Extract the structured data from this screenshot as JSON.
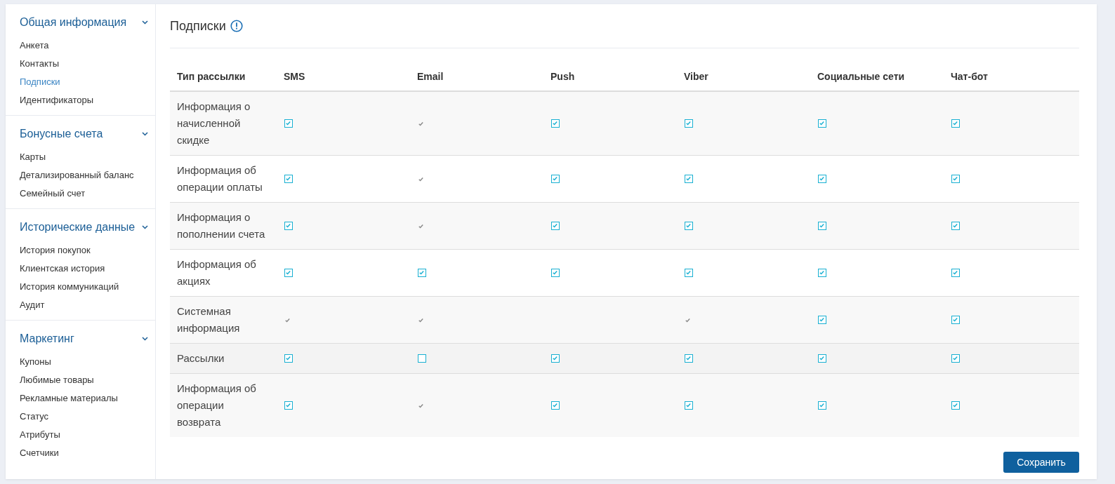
{
  "sidebar": {
    "groups": [
      {
        "title": "Общая информация",
        "expanded": true,
        "items": [
          {
            "label": "Анкета",
            "selected": false
          },
          {
            "label": "Контакты",
            "selected": false
          },
          {
            "label": "Подписки",
            "selected": true
          },
          {
            "label": "Идентификаторы",
            "selected": false
          }
        ]
      },
      {
        "title": "Бонусные счета",
        "expanded": true,
        "items": [
          {
            "label": "Карты",
            "selected": false
          },
          {
            "label": "Детализированный баланс",
            "selected": false
          },
          {
            "label": "Семейный счет",
            "selected": false
          }
        ]
      },
      {
        "title": "Исторические данные",
        "expanded": true,
        "items": [
          {
            "label": "История покупок",
            "selected": false
          },
          {
            "label": "Клиентская история",
            "selected": false
          },
          {
            "label": "История коммуникаций",
            "selected": false
          },
          {
            "label": "Аудит",
            "selected": false
          }
        ]
      },
      {
        "title": "Маркетинг",
        "expanded": true,
        "items": [
          {
            "label": "Купоны",
            "selected": false
          },
          {
            "label": "Любимые товары",
            "selected": false
          },
          {
            "label": "Рекламные материалы",
            "selected": false
          },
          {
            "label": "Статус",
            "selected": false
          },
          {
            "label": "Атрибуты",
            "selected": false
          },
          {
            "label": "Счетчики",
            "selected": false
          }
        ]
      }
    ]
  },
  "page": {
    "title": "Подписки"
  },
  "table": {
    "columns": [
      "Тип рассылки",
      "SMS",
      "Email",
      "Push",
      "Viber",
      "Социальные сети",
      "Чат-бот"
    ],
    "rows": [
      {
        "label": "Информация о начисленной скидке",
        "highlighted": false,
        "cells": [
          {
            "kind": "checkbox",
            "checked": true
          },
          {
            "kind": "fixed"
          },
          {
            "kind": "checkbox",
            "checked": true
          },
          {
            "kind": "checkbox",
            "checked": true
          },
          {
            "kind": "checkbox",
            "checked": true
          },
          {
            "kind": "checkbox",
            "checked": true
          }
        ]
      },
      {
        "label": "Информация об операции оплаты",
        "highlighted": false,
        "cells": [
          {
            "kind": "checkbox",
            "checked": true
          },
          {
            "kind": "fixed"
          },
          {
            "kind": "checkbox",
            "checked": true
          },
          {
            "kind": "checkbox",
            "checked": true
          },
          {
            "kind": "checkbox",
            "checked": true
          },
          {
            "kind": "checkbox",
            "checked": true
          }
        ]
      },
      {
        "label": "Информация о пополнении счета",
        "highlighted": false,
        "cells": [
          {
            "kind": "checkbox",
            "checked": true
          },
          {
            "kind": "fixed"
          },
          {
            "kind": "checkbox",
            "checked": true
          },
          {
            "kind": "checkbox",
            "checked": true
          },
          {
            "kind": "checkbox",
            "checked": true
          },
          {
            "kind": "checkbox",
            "checked": true
          }
        ]
      },
      {
        "label": "Информация об акциях",
        "highlighted": false,
        "cells": [
          {
            "kind": "checkbox",
            "checked": true
          },
          {
            "kind": "checkbox",
            "checked": true
          },
          {
            "kind": "checkbox",
            "checked": true
          },
          {
            "kind": "checkbox",
            "checked": true
          },
          {
            "kind": "checkbox",
            "checked": true
          },
          {
            "kind": "checkbox",
            "checked": true
          }
        ]
      },
      {
        "label": "Системная информация",
        "highlighted": false,
        "cells": [
          {
            "kind": "fixed"
          },
          {
            "kind": "fixed"
          },
          {
            "kind": "none"
          },
          {
            "kind": "fixed"
          },
          {
            "kind": "checkbox",
            "checked": true
          },
          {
            "kind": "checkbox",
            "checked": true
          }
        ]
      },
      {
        "label": "Рассылки",
        "highlighted": true,
        "cells": [
          {
            "kind": "checkbox",
            "checked": true
          },
          {
            "kind": "checkbox",
            "checked": false
          },
          {
            "kind": "checkbox",
            "checked": true
          },
          {
            "kind": "checkbox",
            "checked": true
          },
          {
            "kind": "checkbox",
            "checked": true
          },
          {
            "kind": "checkbox",
            "checked": true
          }
        ]
      },
      {
        "label": "Информация об операции возврата",
        "highlighted": false,
        "cells": [
          {
            "kind": "checkbox",
            "checked": true
          },
          {
            "kind": "fixed"
          },
          {
            "kind": "checkbox",
            "checked": true
          },
          {
            "kind": "checkbox",
            "checked": true
          },
          {
            "kind": "checkbox",
            "checked": true
          },
          {
            "kind": "checkbox",
            "checked": true
          }
        ]
      }
    ]
  },
  "buttons": {
    "save": "Сохранить"
  }
}
